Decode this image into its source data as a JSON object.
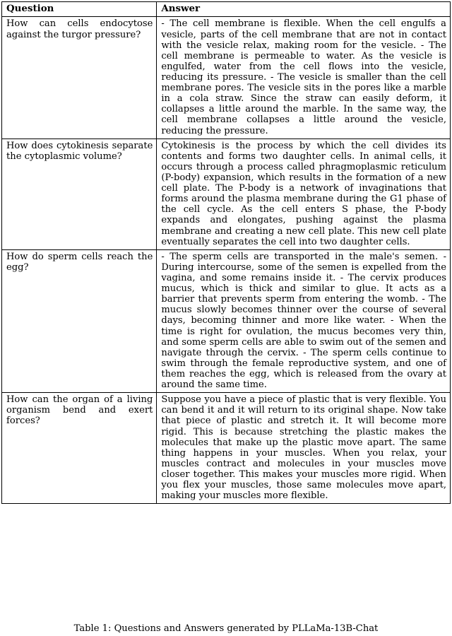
{
  "table": {
    "headers": {
      "question": "Question",
      "answer": "Answer"
    },
    "rows": [
      {
        "question": "How can cells endocytose against the turgor pressure?",
        "answer": "- The cell membrane is flexible. When the cell engulfs a vesicle, parts of the cell membrane that are not in contact with the vesicle relax, making room for the vesicle. - The cell membrane is permeable to water. As the vesicle is engulfed, water from the cell flows into the vesicle, reducing its pressure. - The vesicle is smaller than the cell membrane pores. The vesicle sits in the pores like a marble in a cola straw. Since the straw can easily deform, it collapses a little around the marble. In the same way, the cell membrane collapses a little around the vesicle, reducing the pressure."
      },
      {
        "question": "How does cytokinesis separate the cytoplasmic volume?",
        "answer": "Cytokinesis is the process by which the cell divides its contents and forms two daughter cells. In animal cells, it occurs through a process called phragmoplasmic reticulum (P-body) expansion, which results in the formation of a new cell plate. The P-body is a network of invaginations that forms around the plasma membrane during the G1 phase of the cell cycle. As the cell enters S phase, the P-body expands and elongates, pushing against the plasma membrane and creating a new cell plate. This new cell plate eventually separates the cell into two daughter cells."
      },
      {
        "question": "How do sperm cells reach the egg?",
        "answer": "- The sperm cells are transported in the male's semen. - During intercourse, some of the semen is expelled from the vagina, and some remains inside it. - The cervix produces mucus, which is thick and similar to glue. It acts as a barrier that prevents sperm from entering the womb. - The mucus slowly becomes thinner over the course of several days, becoming thinner and more like water. - When the time is right for ovulation, the mucus becomes very thin, and some sperm cells are able to swim out of the semen and navigate through the cervix. - The sperm cells continue to swim through the female reproductive system, and one of them reaches the egg, which is released from the ovary at around the same time."
      },
      {
        "question": "How can the organ of a living organism bend and exert forces?",
        "answer": "Suppose you have a piece of plastic that is very flexible. You can bend it and it will return to its original shape. Now take that piece of plastic and stretch it. It will become more rigid. This is because stretching the plastic makes the molecules that make up the plastic move apart. The same thing happens in your muscles. When you relax, your muscles contract and molecules in your muscles move closer together. This makes your muscles more rigid. When you flex your muscles, those same molecules move apart, making your muscles more flexible."
      }
    ]
  },
  "caption": {
    "text": "Table 1: Questions and Answers generated by PLLaMa-13B-Chat"
  }
}
